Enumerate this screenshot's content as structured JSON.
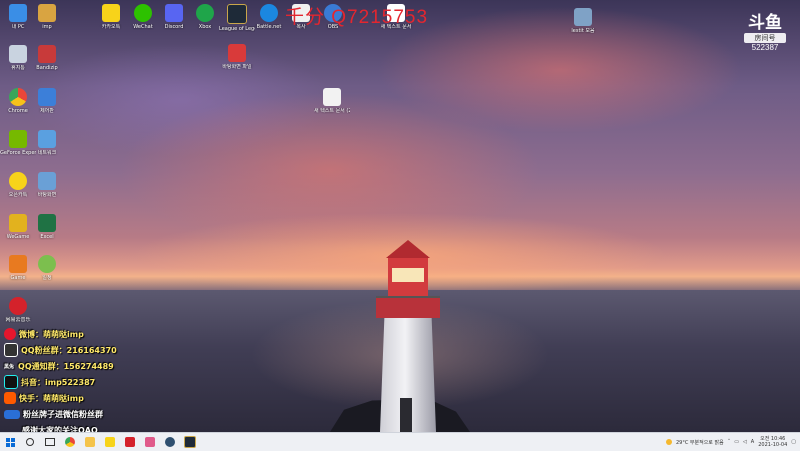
{
  "watermark": "千分 Q7215753",
  "douyu": {
    "mark": "斗鱼",
    "room_label": "房间号",
    "room_number": "522387"
  },
  "desktop_icons": [
    {
      "label": "내 PC",
      "color": "#3a8ee6"
    },
    {
      "label": "imp",
      "color": "#d9a441"
    },
    {
      "label": "휴지통",
      "color": "#c9d3e0"
    },
    {
      "label": "Bandizip",
      "color": "#c83a3a"
    },
    {
      "label": "Chrome",
      "color": "#e9463a"
    },
    {
      "label": "제어판",
      "color": "#3c7fd9"
    },
    {
      "label": "GeForce Experience",
      "color": "#76b900"
    },
    {
      "label": "네트워크",
      "color": "#5aa0e0"
    },
    {
      "label": "오픈카톡",
      "color": "#f7d31a"
    },
    {
      "label": "바탕화면",
      "color": "#6aa0d6"
    },
    {
      "label": "WeGame",
      "color": "#e2b21e"
    },
    {
      "label": "Excel",
      "color": "#1f7244"
    },
    {
      "label": "Game",
      "color": "#e87a20"
    },
    {
      "label": "일정",
      "color": "#7cbf4e"
    },
    {
      "label": "网易云音乐",
      "color": "#d4222b"
    }
  ],
  "top_icons": [
    {
      "label": "카카오톡",
      "color": "#f7d31a"
    },
    {
      "label": "WeChat",
      "color": "#2dc100"
    },
    {
      "label": "Discord",
      "color": "#5865f2"
    },
    {
      "label": "Xbox",
      "color": "#1fa54a"
    },
    {
      "label": "League of Legends",
      "color": "#1e2a38"
    },
    {
      "label": "Battle.net",
      "color": "#1b87e0"
    },
    {
      "label": "복사",
      "color": "#f0f0f0"
    },
    {
      "label": "OBS",
      "color": "#3a7bd5"
    },
    {
      "label": "새 텍스트 문서",
      "color": "#ffffff"
    },
    {
      "label": "lestit 모음",
      "color": "#7fa2c6"
    }
  ],
  "pdf_icon": {
    "label": "바탕화면 파일",
    "color": "#d93a3a"
  },
  "file_icon": {
    "label": "새 텍스트 문서 (2)",
    "color": "#f2f2f2"
  },
  "overlay": {
    "weibo": "微博：萌萌哒imp",
    "qq_fans": "QQ粉丝群：216164370",
    "qq_notice": "QQ通知群：156274489",
    "avatar_label": "黑兔",
    "douyin": "抖音：imp522387",
    "kuaishou": "快手：萌萌哒imp",
    "fans_tag": "粉丝牌子进微信粉丝群",
    "thanks": "感谢大家的关注QAQ"
  },
  "taskbar": {
    "weather": "29°C 부분적으로 맑음",
    "lang": "A",
    "time": "오전 10:46",
    "date": "2021-10-04"
  }
}
